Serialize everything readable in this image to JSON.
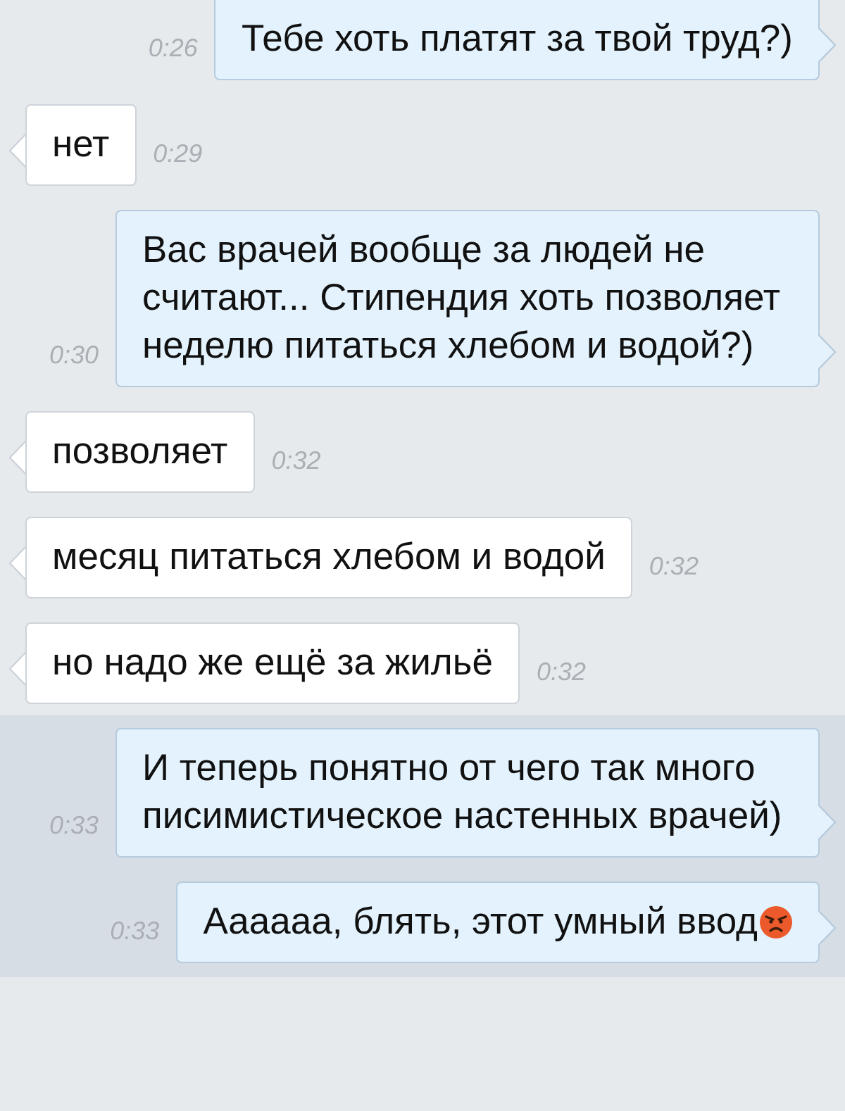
{
  "messages": [
    {
      "kind": "outgoing",
      "text": "Тебе хоть платят за твой труд?)",
      "time": "0:26",
      "selected": false
    },
    {
      "kind": "incoming",
      "text": "нет",
      "time": "0:29",
      "selected": false
    },
    {
      "kind": "outgoing",
      "text": "Вас врачей вообще за людей не считают... Стипендия хоть позволяет неделю питаться хлебом и водой?)",
      "time": "0:30",
      "selected": false
    },
    {
      "kind": "incoming",
      "text": "позволяет",
      "time": "0:32",
      "selected": false
    },
    {
      "kind": "incoming",
      "text": "месяц питаться хлебом и водой",
      "time": "0:32",
      "selected": false
    },
    {
      "kind": "incoming",
      "text": "но надо же ещё за жильё",
      "time": "0:32",
      "selected": false
    },
    {
      "kind": "outgoing",
      "text": "И теперь понятно от чего так много писимистическое настенных врачей)",
      "time": "0:33",
      "selected": true
    },
    {
      "kind": "outgoing",
      "text": "Аааааа, блять, этот умный ввод",
      "time": "0:33",
      "selected": true,
      "emoji": true
    }
  ]
}
